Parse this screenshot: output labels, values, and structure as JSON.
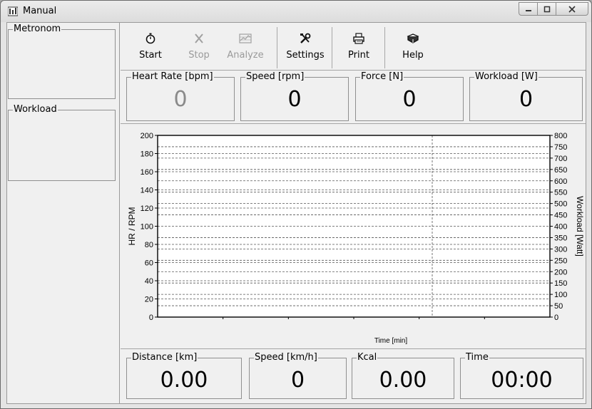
{
  "window": {
    "title": "Manual"
  },
  "left_panel": {
    "metronom_label": "Metronom",
    "workload_label": "Workload"
  },
  "toolbar": {
    "start": "Start",
    "stop": "Stop",
    "analyze": "Analyze",
    "settings": "Settings",
    "print": "Print",
    "help": "Help"
  },
  "readouts_top": [
    {
      "label": "Heart Rate [bpm]",
      "value": "0"
    },
    {
      "label": "Speed [rpm]",
      "value": "0"
    },
    {
      "label": "Force [N]",
      "value": "0"
    },
    {
      "label": "Workload [W]",
      "value": "0"
    }
  ],
  "readouts_bottom": [
    {
      "label": "Distance [km]",
      "value": "0.00"
    },
    {
      "label": "Speed [km/h]",
      "value": "0"
    },
    {
      "label": "Kcal",
      "value": "0.00"
    },
    {
      "label": "Time",
      "value": "00:00"
    }
  ],
  "chart_data": {
    "type": "line",
    "xlabel": "Time [min]",
    "ylabel": "HR / RPM",
    "y2label": "Workload [Watt]",
    "ylim": [
      0,
      200
    ],
    "y2lim": [
      0,
      800
    ],
    "yticks": [
      "0",
      "20",
      "40",
      "60",
      "80",
      "100",
      "120",
      "140",
      "160",
      "180",
      "200"
    ],
    "y2ticks": [
      "0",
      "50",
      "100",
      "150",
      "200",
      "250",
      "300",
      "350",
      "400",
      "450",
      "500",
      "550",
      "600",
      "650",
      "700",
      "750",
      "800"
    ],
    "series": []
  }
}
